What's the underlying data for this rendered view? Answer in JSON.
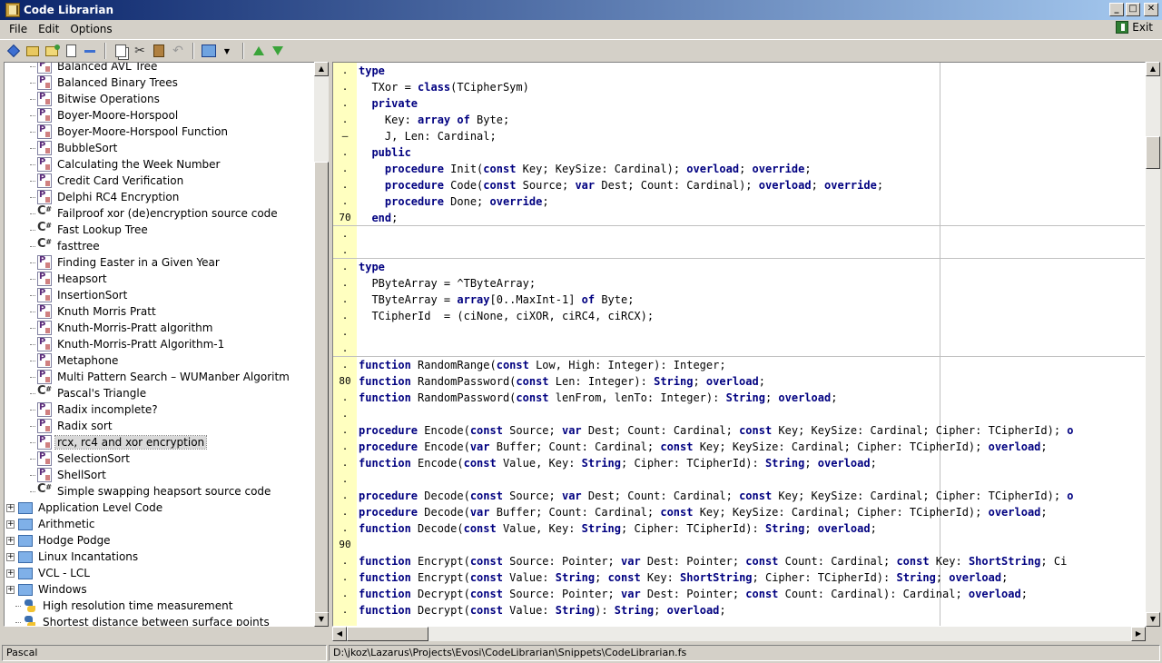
{
  "window": {
    "title": "Code Librarian"
  },
  "menu": {
    "items": [
      "File",
      "Edit",
      "Options"
    ],
    "exit_label": "Exit"
  },
  "tree": {
    "items": [
      {
        "label": "Balanced AVL Tree",
        "kind": "leaf",
        "icon": "pascal-file-icon"
      },
      {
        "label": "Balanced Binary Trees",
        "kind": "leaf",
        "icon": "pascal-file-icon"
      },
      {
        "label": "Bitwise Operations",
        "kind": "leaf",
        "icon": "pascal-file-icon"
      },
      {
        "label": "Boyer-Moore-Horspool",
        "kind": "leaf",
        "icon": "pascal-file-icon"
      },
      {
        "label": "Boyer-Moore-Horspool Function",
        "kind": "leaf",
        "icon": "pascal-file-icon"
      },
      {
        "label": "BubbleSort",
        "kind": "leaf",
        "icon": "pascal-file-icon"
      },
      {
        "label": "Calculating the Week Number",
        "kind": "leaf",
        "icon": "pascal-file-icon"
      },
      {
        "label": "Credit Card Verification",
        "kind": "leaf",
        "icon": "pascal-file-icon"
      },
      {
        "label": "Delphi RC4 Encryption",
        "kind": "leaf",
        "icon": "pascal-file-icon"
      },
      {
        "label": "Failproof xor (de)encryption source code",
        "kind": "leaf",
        "icon": "csharp-file-icon"
      },
      {
        "label": "Fast Lookup Tree",
        "kind": "leaf",
        "icon": "csharp-file-icon"
      },
      {
        "label": "fasttree",
        "kind": "leaf",
        "icon": "csharp-file-icon"
      },
      {
        "label": "Finding Easter in a Given Year",
        "kind": "leaf",
        "icon": "pascal-file-icon"
      },
      {
        "label": "Heapsort",
        "kind": "leaf",
        "icon": "pascal-file-icon"
      },
      {
        "label": "InsertionSort",
        "kind": "leaf",
        "icon": "pascal-file-icon"
      },
      {
        "label": "Knuth Morris Pratt",
        "kind": "leaf",
        "icon": "pascal-file-icon"
      },
      {
        "label": "Knuth-Morris-Pratt algorithm",
        "kind": "leaf",
        "icon": "pascal-file-icon"
      },
      {
        "label": "Knuth-Morris-Pratt Algorithm-1",
        "kind": "leaf",
        "icon": "pascal-file-icon"
      },
      {
        "label": "Metaphone",
        "kind": "leaf",
        "icon": "pascal-file-icon"
      },
      {
        "label": "Multi Pattern Search – WUManber Algoritm",
        "kind": "leaf",
        "icon": "pascal-file-icon"
      },
      {
        "label": "Pascal's Triangle",
        "kind": "leaf",
        "icon": "csharp-file-icon"
      },
      {
        "label": "Radix incomplete?",
        "kind": "leaf",
        "icon": "pascal-file-icon"
      },
      {
        "label": "Radix sort",
        "kind": "leaf",
        "icon": "pascal-file-icon"
      },
      {
        "label": "rcx, rc4 and xor encryption",
        "kind": "leaf",
        "icon": "pascal-file-icon",
        "selected": true
      },
      {
        "label": "SelectionSort",
        "kind": "leaf",
        "icon": "pascal-file-icon"
      },
      {
        "label": "ShellSort",
        "kind": "leaf",
        "icon": "pascal-file-icon"
      },
      {
        "label": "Simple swapping heapsort source code",
        "kind": "leaf",
        "icon": "csharp-file-icon"
      },
      {
        "label": "Application Level Code",
        "kind": "group",
        "icon": "folder-icon"
      },
      {
        "label": "Arithmetic",
        "kind": "group",
        "icon": "folder-icon"
      },
      {
        "label": "Hodge Podge",
        "kind": "group",
        "icon": "folder-icon"
      },
      {
        "label": "Linux Incantations",
        "kind": "group",
        "icon": "folder-icon"
      },
      {
        "label": "VCL - LCL",
        "kind": "group",
        "icon": "folder-icon"
      },
      {
        "label": "Windows",
        "kind": "group",
        "icon": "folder-icon"
      },
      {
        "label": "High resolution time measurement",
        "kind": "root-leaf",
        "icon": "python-file-icon"
      },
      {
        "label": "Shortest distance between surface points",
        "kind": "root-leaf",
        "icon": "python-file-icon"
      }
    ]
  },
  "editor": {
    "lines": [
      {
        "ln": ".",
        "code": "<k>type</k>"
      },
      {
        "ln": ".",
        "code": "  TXor = <k>class</k>(TCipherSym)"
      },
      {
        "ln": ".",
        "code": "  <k>private</k>"
      },
      {
        "ln": ".",
        "code": "    Key: <k>array of</k> Byte;"
      },
      {
        "ln": "–",
        "code": "    J, Len: Cardinal;"
      },
      {
        "ln": ".",
        "code": "  <k>public</k>"
      },
      {
        "ln": ".",
        "code": "    <k>procedure</k> Init(<k>const</k> Key; KeySize: Cardinal); <k>overload</k>; <k>override</k>;"
      },
      {
        "ln": ".",
        "code": "    <k>procedure</k> Code(<k>const</k> Source; <k>var</k> Dest; Count: Cardinal); <k>overload</k>; <k>override</k>;"
      },
      {
        "ln": ".",
        "code": "    <k>procedure</k> Done; <k>override</k>;"
      },
      {
        "ln": "70",
        "code": "  <k>end</k>;",
        "sep": true
      },
      {
        "ln": ".",
        "code": ""
      },
      {
        "ln": ".",
        "code": "",
        "sep": true
      },
      {
        "ln": ".",
        "code": "<k>type</k>"
      },
      {
        "ln": ".",
        "code": "  PByteArray = ^TByteArray;"
      },
      {
        "ln": ".",
        "code": "  TByteArray = <k>array</k>[0..MaxInt-1] <k>of</k> Byte;"
      },
      {
        "ln": ".",
        "code": "  TCipherId  = (ciNone, ciXOR, ciRC4, ciRCX);"
      },
      {
        "ln": ".",
        "code": ""
      },
      {
        "ln": ".",
        "code": "",
        "sep": true
      },
      {
        "ln": ".",
        "code": "<k>function</k> RandomRange(<k>const</k> Low, High: Integer): Integer;"
      },
      {
        "ln": "80",
        "code": "<k>function</k> RandomPassword(<k>const</k> Len: Integer): <k>String</k>; <k>overload</k>;"
      },
      {
        "ln": ".",
        "code": "<k>function</k> RandomPassword(<k>const</k> lenFrom, lenTo: Integer): <k>String</k>; <k>overload</k>;"
      },
      {
        "ln": ".",
        "code": ""
      },
      {
        "ln": ".",
        "code": "<k>procedure</k> Encode(<k>const</k> Source; <k>var</k> Dest; Count: Cardinal; <k>const</k> Key; KeySize: Cardinal; Cipher: TCipherId); <k>o</k>"
      },
      {
        "ln": ".",
        "code": "<k>procedure</k> Encode(<k>var</k> Buffer; Count: Cardinal; <k>const</k> Key; KeySize: Cardinal; Cipher: TCipherId); <k>overload</k>;"
      },
      {
        "ln": ".",
        "code": "<k>function</k> Encode(<k>const</k> Value, Key: <k>String</k>; Cipher: TCipherId): <k>String</k>; <k>overload</k>;"
      },
      {
        "ln": ".",
        "code": ""
      },
      {
        "ln": ".",
        "code": "<k>procedure</k> Decode(<k>const</k> Source; <k>var</k> Dest; Count: Cardinal; <k>const</k> Key; KeySize: Cardinal; Cipher: TCipherId); <k>o</k>"
      },
      {
        "ln": ".",
        "code": "<k>procedure</k> Decode(<k>var</k> Buffer; Count: Cardinal; <k>const</k> Key; KeySize: Cardinal; Cipher: TCipherId); <k>overload</k>;"
      },
      {
        "ln": ".",
        "code": "<k>function</k> Decode(<k>const</k> Value, Key: <k>String</k>; Cipher: TCipherId): <k>String</k>; <k>overload</k>;"
      },
      {
        "ln": "90",
        "code": ""
      },
      {
        "ln": ".",
        "code": "<k>function</k> Encrypt(<k>const</k> Source: Pointer; <k>var</k> Dest: Pointer; <k>const</k> Count: Cardinal; <k>const</k> Key: <k>ShortString</k>; Ci"
      },
      {
        "ln": ".",
        "code": "<k>function</k> Encrypt(<k>const</k> Value: <k>String</k>; <k>const</k> Key: <k>ShortString</k>; Cipher: TCipherId): <k>String</k>; <k>overload</k>;"
      },
      {
        "ln": ".",
        "code": "<k>function</k> Decrypt(<k>const</k> Source: Pointer; <k>var</k> Dest: Pointer; <k>const</k> Count: Cardinal): Cardinal; <k>overload</k>;"
      },
      {
        "ln": ".",
        "code": "<k>function</k> Decrypt(<k>const</k> Value: <k>String</k>): <k>String</k>; <k>overload</k>;"
      }
    ]
  },
  "status": {
    "language": "Pascal",
    "path": "D:\\jkoz\\Lazarus\\Projects\\Evosi\\CodeLibrarian\\Snippets\\CodeLibrarian.fs"
  },
  "colors": {
    "title_bar_start": "#0a246a",
    "title_bar_end": "#a6caf0",
    "gutter": "#ffffc0",
    "keyword": "#000080"
  }
}
